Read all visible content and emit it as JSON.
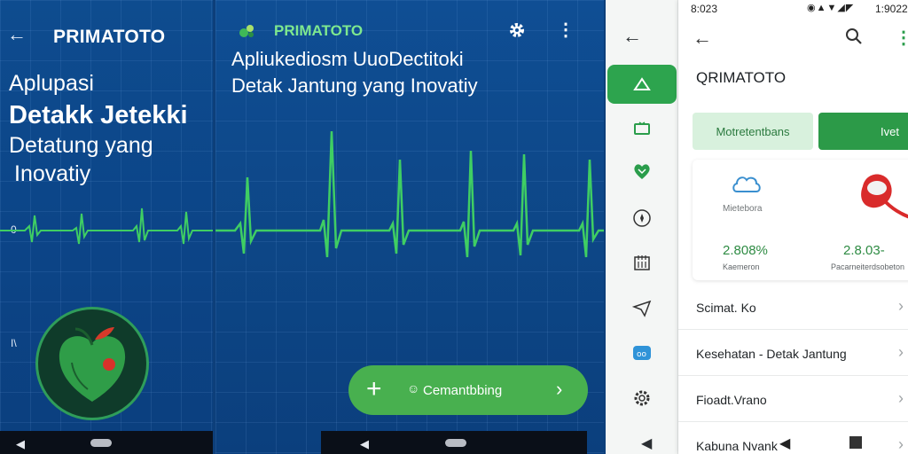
{
  "screen1": {
    "title": "PRIMATOTO",
    "back_icon": "arrow-back-icon",
    "tagline": [
      "Aplupasi",
      "Detakk Jetekki",
      "Detatung yang",
      "Inovatiy"
    ],
    "axis_labels": [
      "0",
      "I\\"
    ],
    "colors": {
      "ecg": "#3fce63",
      "background": "#0c4588"
    }
  },
  "screen2": {
    "title": "PRIMATOTO",
    "subtitle_line1": "Apliukediosm UuoDectitoki",
    "subtitle_line2": "Detak Jantung yang Inovatiy",
    "cta": {
      "label": "Cemantbbing",
      "icon": "plus-icon"
    },
    "colors": {
      "title": "#7ee88f",
      "cta": "#48b04f"
    }
  },
  "screen3": {
    "status_time": "8:023",
    "status_battery": "1:9022",
    "title": "QRIMATOTO",
    "rail_items": [
      "home-icon",
      "tv-icon",
      "heart-icon",
      "compass-icon",
      "calendar-icon",
      "send-icon",
      "chat-icon",
      "settings-icon"
    ],
    "buttons": {
      "secondary": "Motretentbans",
      "primary": "Ivet"
    },
    "card": {
      "icon_label": "Mietebora",
      "stat1_value": "2.808%",
      "stat1_label": "Kaemeron",
      "stat2_value": "2.8.03-",
      "stat2_label": "Pacarneiterdsobeton"
    },
    "list": [
      "Scimat. Ko",
      "Kesehatan - Detak Jantung",
      "Fioadt.Vrano",
      "Kabuna Nvank"
    ],
    "colors": {
      "accent": "#2c9a48"
    }
  }
}
